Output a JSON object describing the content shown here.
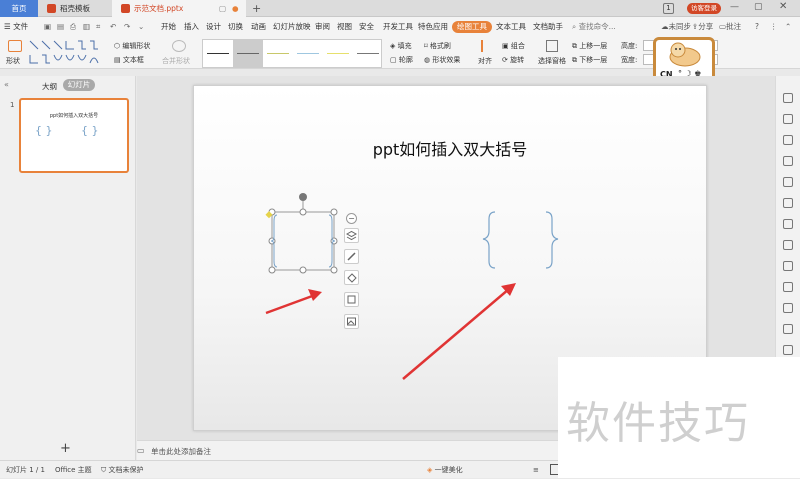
{
  "tabs": {
    "home": "首页",
    "templates": "稻壳模板",
    "document": "示范文档.pptx",
    "new_tab": "+",
    "page_count": "1",
    "login": "访客登录"
  },
  "menu": {
    "file": "文件",
    "items": [
      "开始",
      "插入",
      "设计",
      "切换",
      "动画",
      "幻灯片放映",
      "审阅",
      "视图",
      "安全",
      "开发工具",
      "特色应用",
      "绘图工具",
      "文本工具",
      "文档助手"
    ],
    "search": "查找命令...",
    "sync": "未同步",
    "share": "分享",
    "comment": "批注"
  },
  "ribbon": {
    "shape": "形状",
    "edit_shape": "编辑形状",
    "text_box": "文本框",
    "merge_shape": "合并形状",
    "fill": "填充",
    "format_painter": "格式刷",
    "outline": "轮廓",
    "shape_effect": "形状效果",
    "align": "对齐",
    "group": "组合",
    "rotate": "旋转",
    "select_pane": "选择窗格",
    "bring_forward": "上移一层",
    "send_backward": "下移一层",
    "height": "高度:",
    "width": "宽度:"
  },
  "left_panel": {
    "outline_tab": "大纲",
    "slides_tab": "幻灯片",
    "slide_number": "1",
    "thumb_title": "ppt如何插入双大括号",
    "add_slide": "+"
  },
  "slide": {
    "title": "ppt如何插入双大括号"
  },
  "notes": {
    "placeholder": "单击此处添加备注"
  },
  "status": {
    "slide_info": "幻灯片 1 / 1",
    "theme": "Office 主题",
    "protect": "文档未保护",
    "beautify": "一键美化"
  },
  "mascot": {
    "label": "CN"
  },
  "watermark": {
    "text": "软件技巧"
  },
  "colors": {
    "accent_orange": "#e8823a",
    "home_tab_blue": "#4a7fd6",
    "doc_tab_red": "#d24726",
    "brace_blue": "#7aa3c8",
    "arrow_red": "#e03434"
  }
}
